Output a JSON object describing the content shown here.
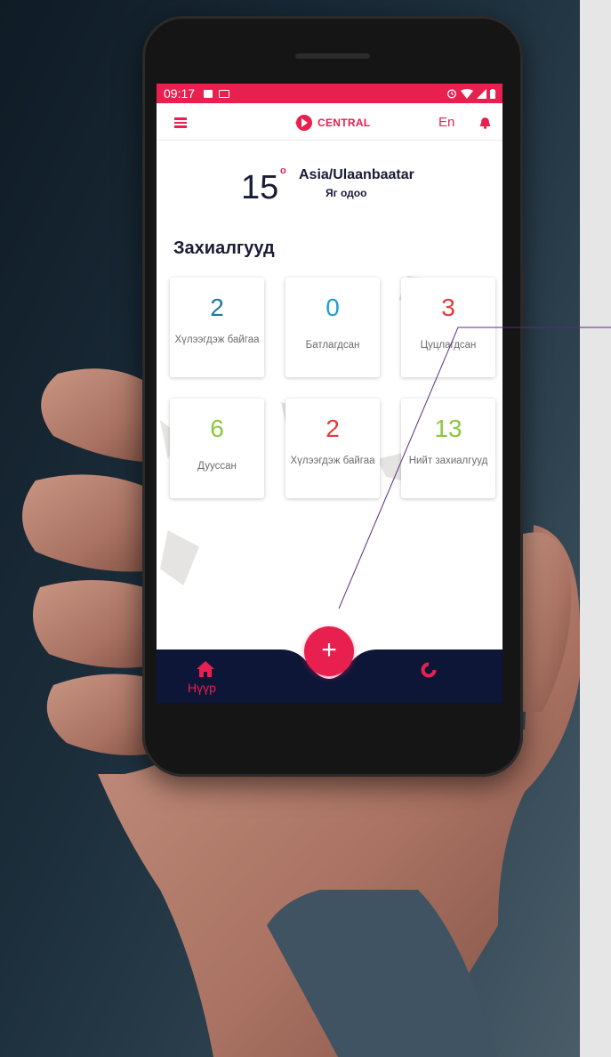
{
  "status_bar": {
    "time": "09:17"
  },
  "header": {
    "brand_name": "CENTRAL",
    "language": "En"
  },
  "weather": {
    "temperature": "15",
    "degree_mark": "o",
    "timezone": "Asia/Ulaanbaatar",
    "now_label": "Яг одоо"
  },
  "orders": {
    "title": "Захиалгууд",
    "cards": [
      {
        "value": "2",
        "label": "Хүлээгдэж байгаа",
        "color": "#1f7aa0"
      },
      {
        "value": "0",
        "label": "Батлагдсан",
        "color": "#1f9ed0"
      },
      {
        "value": "3",
        "label": "Цуцлагдсан",
        "color": "#e53a3a"
      },
      {
        "value": "6",
        "label": "Дууссан",
        "color": "#8dc63f"
      },
      {
        "value": "2",
        "label": "Хүлээгдэж байгаа",
        "color": "#e53a3a"
      },
      {
        "value": "13",
        "label": "Нийт захиалгууд",
        "color": "#8dc63f"
      }
    ]
  },
  "bottom_nav": {
    "home_label": "Нүүр",
    "fab_label": "+"
  },
  "colors": {
    "accent": "#e8204f",
    "nav_background": "#0e1638",
    "heading": "#1a1c35"
  },
  "icons": [
    "menu-icon",
    "bell-icon",
    "home-icon",
    "stats-icon",
    "plus-icon",
    "wifi-icon",
    "battery-icon",
    "alarm-icon"
  ]
}
